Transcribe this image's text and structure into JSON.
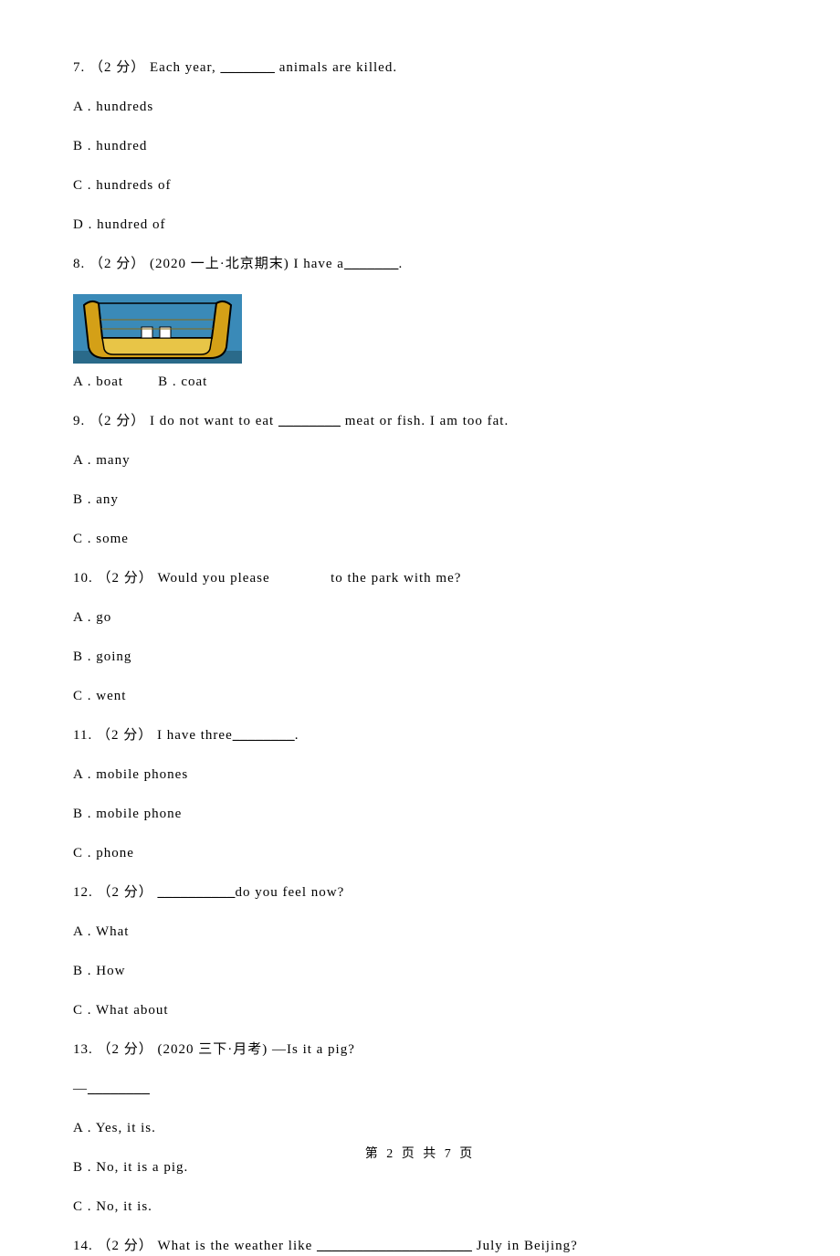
{
  "questions": {
    "q7": {
      "prefix": "7. （2 分） Each year, ",
      "blank": "_______",
      "suffix": " animals are killed.",
      "options": {
        "a": "A . hundreds",
        "b": "B . hundred",
        "c": "C . hundreds of",
        "d": "D . hundred of"
      }
    },
    "q8": {
      "prefix": "8. （2 分） (2020 一上·北京期末) I have a",
      "blank": "_______",
      "suffix": ".",
      "options_inline": "A . boat        B . coat"
    },
    "q9": {
      "prefix": "9. （2 分） I do not want to eat ",
      "blank": "________",
      "suffix": " meat or fish. I am too fat.",
      "options": {
        "a": "A . many",
        "b": "B . any",
        "c": "C . some"
      }
    },
    "q10": {
      "text": "10. （2 分） Would you please              to the park with me?",
      "options": {
        "a": "A . go",
        "b": "B . going",
        "c": "C . went"
      }
    },
    "q11": {
      "prefix": "11. （2 分） I have three",
      "blank": "________",
      "suffix": ".",
      "options": {
        "a": "A . mobile phones",
        "b": "B . mobile phone",
        "c": "C . phone"
      }
    },
    "q12": {
      "prefix": "12. （2 分） ",
      "blank": "__________",
      "suffix": "do you feel now?",
      "options": {
        "a": "A . What",
        "b": "B . How",
        "c": "C . What about"
      }
    },
    "q13": {
      "text": "13. （2 分） (2020 三下·月考) —Is it a pig?",
      "dash_prefix": "—",
      "dash_blank": "________",
      "options": {
        "a": "A . Yes, it is.",
        "b": "B . No, it is a pig.",
        "c": "C . No, it is."
      }
    },
    "q14": {
      "prefix": "14. （2 分） What is the weather like ",
      "blank": "____________________",
      "suffix": " July in Beijing?"
    }
  },
  "footer": "第 2 页 共 7 页"
}
